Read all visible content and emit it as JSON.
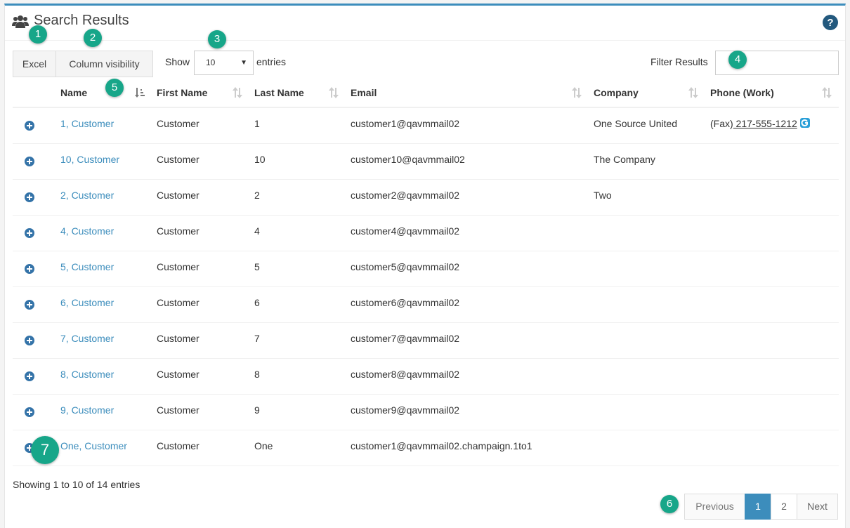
{
  "header": {
    "title": "Search Results",
    "title_icon": "users-icon",
    "help_icon": "question-circle-icon"
  },
  "toolbar": {
    "excel_label": "Excel",
    "colvis_label": "Column visibility",
    "show_label": "Show",
    "entries_value": "10",
    "entries_label": "entries",
    "filter_label": "Filter Results",
    "filter_value": ""
  },
  "table": {
    "columns": [
      "Name",
      "First Name",
      "Last Name",
      "Email",
      "Company",
      "Phone (Work)"
    ],
    "rows": [
      {
        "name": "1, Customer",
        "first": "Customer",
        "last": "1",
        "email": "customer1@qavmmail02",
        "company": "One Source United",
        "phone_prefix": "(Fax)",
        "phone": " 217-555-1212"
      },
      {
        "name": "10, Customer",
        "first": "Customer",
        "last": "10",
        "email": "customer10@qavmmail02",
        "company": "The Company",
        "phone_prefix": "",
        "phone": ""
      },
      {
        "name": "2, Customer",
        "first": "Customer",
        "last": "2",
        "email": "customer2@qavmmail02",
        "company": "Two",
        "phone_prefix": "",
        "phone": ""
      },
      {
        "name": "4, Customer",
        "first": "Customer",
        "last": "4",
        "email": "customer4@qavmmail02",
        "company": "",
        "phone_prefix": "",
        "phone": ""
      },
      {
        "name": "5, Customer",
        "first": "Customer",
        "last": "5",
        "email": "customer5@qavmmail02",
        "company": "",
        "phone_prefix": "",
        "phone": ""
      },
      {
        "name": "6, Customer",
        "first": "Customer",
        "last": "6",
        "email": "customer6@qavmmail02",
        "company": "",
        "phone_prefix": "",
        "phone": ""
      },
      {
        "name": "7, Customer",
        "first": "Customer",
        "last": "7",
        "email": "customer7@qavmmail02",
        "company": "",
        "phone_prefix": "",
        "phone": ""
      },
      {
        "name": "8, Customer",
        "first": "Customer",
        "last": "8",
        "email": "customer8@qavmmail02",
        "company": "",
        "phone_prefix": "",
        "phone": ""
      },
      {
        "name": "9, Customer",
        "first": "Customer",
        "last": "9",
        "email": "customer9@qavmmail02",
        "company": "",
        "phone_prefix": "",
        "phone": ""
      },
      {
        "name": "One, Customer",
        "first": "Customer",
        "last": "One",
        "email": "customer1@qavmmail02.champaign.1to1",
        "company": "",
        "phone_prefix": "",
        "phone": ""
      }
    ]
  },
  "footer": {
    "info": "Showing 1 to 10 of 14 entries",
    "pagination": {
      "previous": "Previous",
      "pages": [
        "1",
        "2"
      ],
      "next": "Next"
    }
  },
  "annotations": [
    "1",
    "2",
    "3",
    "4",
    "5",
    "6",
    "7"
  ],
  "colors": {
    "accent": "#3c8dbc",
    "badge": "#17a689"
  }
}
